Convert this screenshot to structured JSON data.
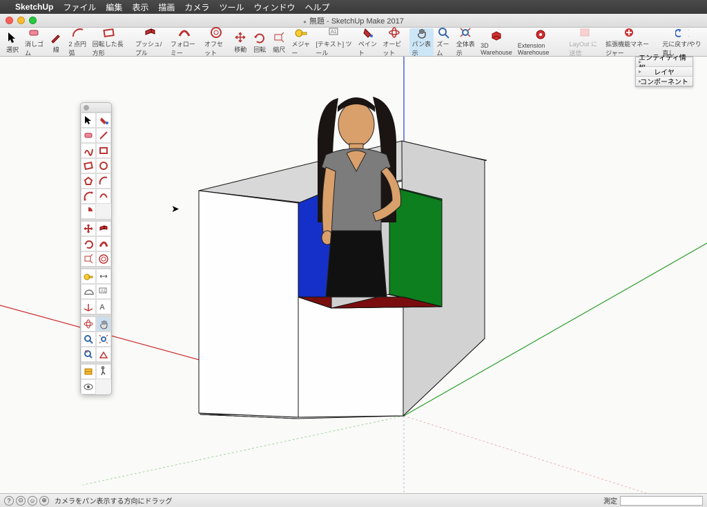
{
  "menu": {
    "apple": "",
    "app": "SketchUp",
    "items": [
      "ファイル",
      "編集",
      "表示",
      "描画",
      "カメラ",
      "ツール",
      "ウィンドウ",
      "ヘルプ"
    ]
  },
  "title": "無題 - SketchUp Make 2017",
  "toolbar": [
    {
      "n": "select",
      "l": "選択",
      "i": "cursor"
    },
    {
      "n": "eraser",
      "l": "消しゴム",
      "i": "eraser"
    },
    {
      "n": "line",
      "l": "線",
      "i": "pencil"
    },
    {
      "n": "arc",
      "l": "2 点円弧",
      "i": "arc"
    },
    {
      "n": "rect",
      "l": "回転した長方形",
      "i": "rect"
    },
    {
      "sep": true
    },
    {
      "n": "pushpull",
      "l": "プッシュ/プル",
      "i": "push"
    },
    {
      "n": "followme",
      "l": "フォローミー",
      "i": "follow"
    },
    {
      "n": "offset",
      "l": "オフセット",
      "i": "offset"
    },
    {
      "n": "move",
      "l": "移動",
      "i": "move"
    },
    {
      "n": "rotate",
      "l": "回転",
      "i": "rotate"
    },
    {
      "n": "scale",
      "l": "縮尺",
      "i": "scale"
    },
    {
      "n": "tape",
      "l": "メジャー",
      "i": "tape"
    },
    {
      "n": "text",
      "l": "[テキスト] ツール",
      "i": "text"
    },
    {
      "n": "paint",
      "l": "ペイント",
      "i": "paint"
    },
    {
      "n": "orbit",
      "l": "オービット",
      "i": "orbit"
    },
    {
      "n": "pan",
      "l": "パン表示",
      "i": "pan",
      "sel": true
    },
    {
      "n": "zoom",
      "l": "ズーム",
      "i": "zoom"
    },
    {
      "n": "zoomext",
      "l": "全体表示",
      "i": "zoomext"
    },
    {
      "n": "3dw",
      "l": "3D Warehouse",
      "i": "3dw"
    },
    {
      "n": "ew",
      "l": "Extension Warehouse",
      "i": "ew"
    },
    {
      "n": "layout",
      "l": "LayOut に送信",
      "i": "layout",
      "dis": true
    },
    {
      "n": "extmgr",
      "l": "拡張機能マネージャー",
      "i": "extmgr"
    },
    {
      "sep": true
    },
    {
      "n": "undo",
      "l": "元に戻す/やり直し",
      "i": "undo"
    }
  ],
  "palette": [
    "select",
    "paint",
    "eraser",
    "line",
    "freehand",
    "rect",
    "rotrect",
    "circle",
    "polygon",
    "arc",
    "2arc",
    "3arc",
    "pie",
    "sep",
    "move",
    "pushpull",
    "rotate",
    "followme",
    "scale",
    "offset",
    "sep",
    "tape",
    "dim",
    "protractor",
    "text",
    "axes",
    "3dtext",
    "sep",
    "orbit",
    "pan",
    "zoom",
    "extents",
    "prev",
    "position",
    "sep",
    "section",
    "walk",
    "look"
  ],
  "tray": [
    "エンティティ情報",
    "レイヤ",
    "コンポーネント"
  ],
  "status": {
    "hint": "カメラをパン表示する方向にドラッグ",
    "measure_label": "測定"
  }
}
